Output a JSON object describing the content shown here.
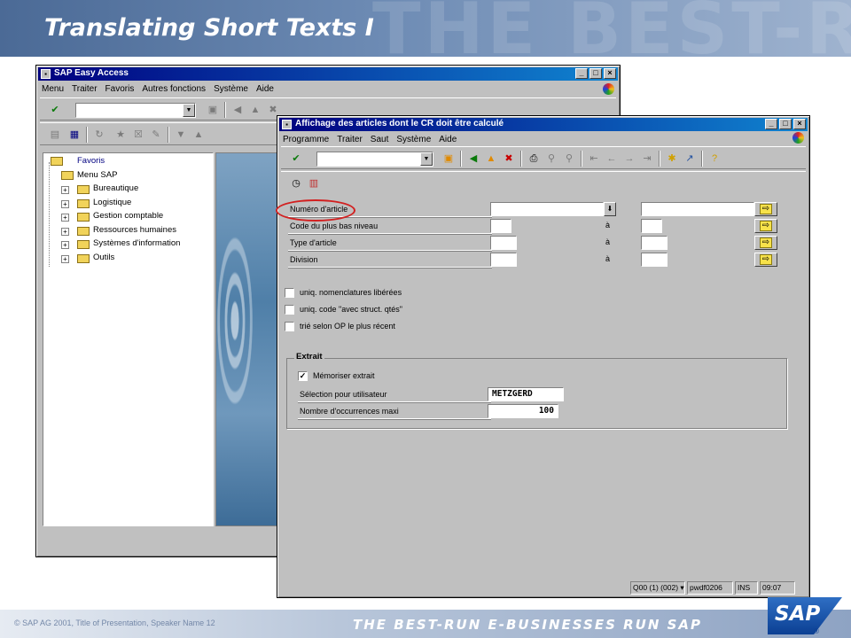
{
  "slide": {
    "title": "Translating Short Texts I",
    "watermark": "THE BEST-RUN E-BUS",
    "footer_copy": "SAP AG 2001, Title of Presentation, Speaker Name 12",
    "footer_tagline": "THE BEST-RUN E-BUSINESSES RUN SAP",
    "logo": "SAP"
  },
  "easy_access": {
    "title": "SAP Easy Access",
    "menu": [
      "Menu",
      "Traiter",
      "Favoris",
      "Autres fonctions",
      "Système",
      "Aide"
    ],
    "tree": {
      "favorites": "Favoris",
      "root": "Menu SAP",
      "children": [
        "Bureautique",
        "Logistique",
        "Gestion comptable",
        "Ressources humaines",
        "Systèmes d'information",
        "Outils"
      ]
    }
  },
  "front": {
    "title": "Affichage des articles dont le CR doit être calculé",
    "menu": [
      "Programme",
      "Traiter",
      "Saut",
      "Système",
      "Aide"
    ],
    "fields": [
      {
        "label": "Numéro d'article",
        "low": "",
        "to_label": "",
        "high": ""
      },
      {
        "label": "Code du plus bas niveau",
        "low": "",
        "to_label": "à",
        "high": ""
      },
      {
        "label": "Type d'article",
        "low": "",
        "to_label": "à",
        "high": ""
      },
      {
        "label": "Division",
        "low": "",
        "to_label": "à",
        "high": ""
      }
    ],
    "checkboxes": [
      {
        "label": "uniq. nomenclatures libérées",
        "checked": false
      },
      {
        "label": "uniq. code \"avec struct. qtés\"",
        "checked": false
      },
      {
        "label": "trié selon OP le plus récent",
        "checked": false
      }
    ],
    "extract": {
      "title": "Extrait",
      "save_label": "Mémoriser extrait",
      "save_checked": true,
      "user_selection_label": "Sélection pour utilisateur",
      "user_selection_value": "METZGERD",
      "max_hits_label": "Nombre d'occurrences maxi",
      "max_hits_value": "100"
    },
    "status": {
      "system": "Q00 (1) (002)",
      "server": "pwdf0206",
      "mode": "INS",
      "time": "09:07"
    }
  },
  "icons": {
    "check": "check-icon",
    "save": "save-icon",
    "back": "back-icon",
    "exit": "exit-icon",
    "cancel": "cancel-icon",
    "print": "print-icon",
    "find": "find-icon",
    "help": "help-icon",
    "execute": "execute-icon"
  },
  "colors": {
    "title_bar": "#000080",
    "highlight": "#d22020",
    "window_bg": "#c0c0c0"
  }
}
